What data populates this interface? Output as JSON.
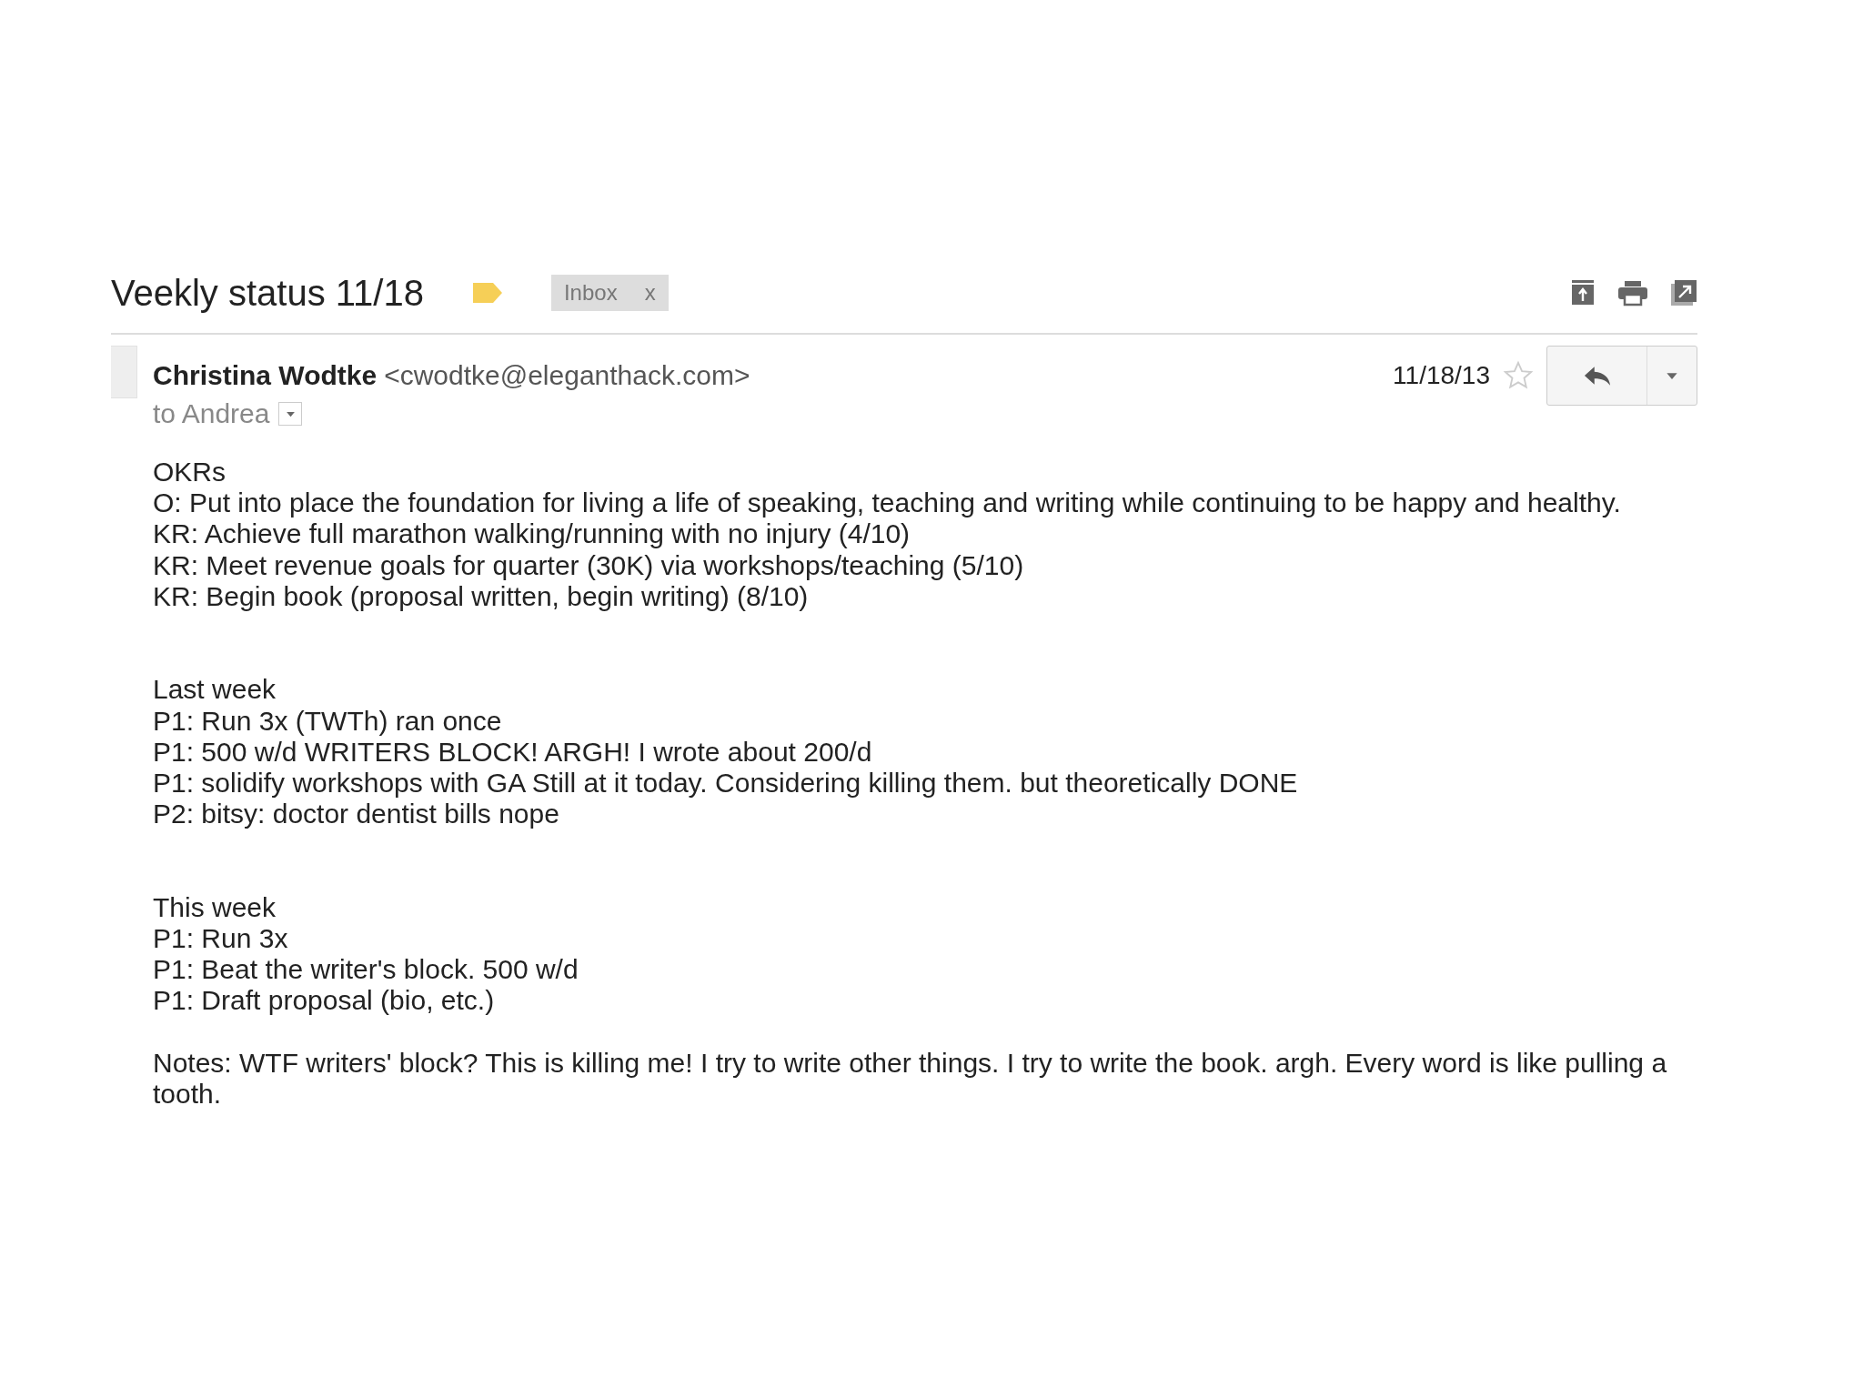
{
  "subject": "Veekly status 11/18",
  "label_chip": {
    "text": "Inbox",
    "remove": "x"
  },
  "message": {
    "sender_name": "Christina Wodtke",
    "sender_email": "<cwodtke@eleganthack.com>",
    "recipient": "to Andrea",
    "date": "11/18/13",
    "starred": false,
    "blocks": [
      {
        "lines": [
          "OKRs",
          "O: Put into place the foundation for living a life of speaking, teaching and writing while continuing to be happy and healthy.",
          "KR: Achieve full marathon walking/running with no injury (4/10)",
          "KR: Meet revenue goals for quarter (30K) via workshops/teaching (5/10)",
          "KR: Begin book (proposal written, begin writing) (8/10)"
        ]
      },
      {
        "lines": [
          "Last week",
          "P1: Run 3x (TWTh)  ran once",
          "P1: 500 w/d WRITERS BLOCK! ARGH! I wrote about 200/d",
          "P1: solidify workshops with GA Still at it today. Considering killing them. but theoretically DONE",
          "P2: bitsy: doctor dentist bills nope"
        ]
      },
      {
        "lines": [
          "This week",
          "P1: Run 3x",
          "P1: Beat the writer's block. 500 w/d",
          "P1: Draft proposal (bio, etc.)"
        ]
      },
      {
        "lines": [
          "Notes: WTF writers' block? This is killing me! I try to write other things. I try to write the book. argh. Every word is like pulling a tooth."
        ]
      }
    ]
  }
}
